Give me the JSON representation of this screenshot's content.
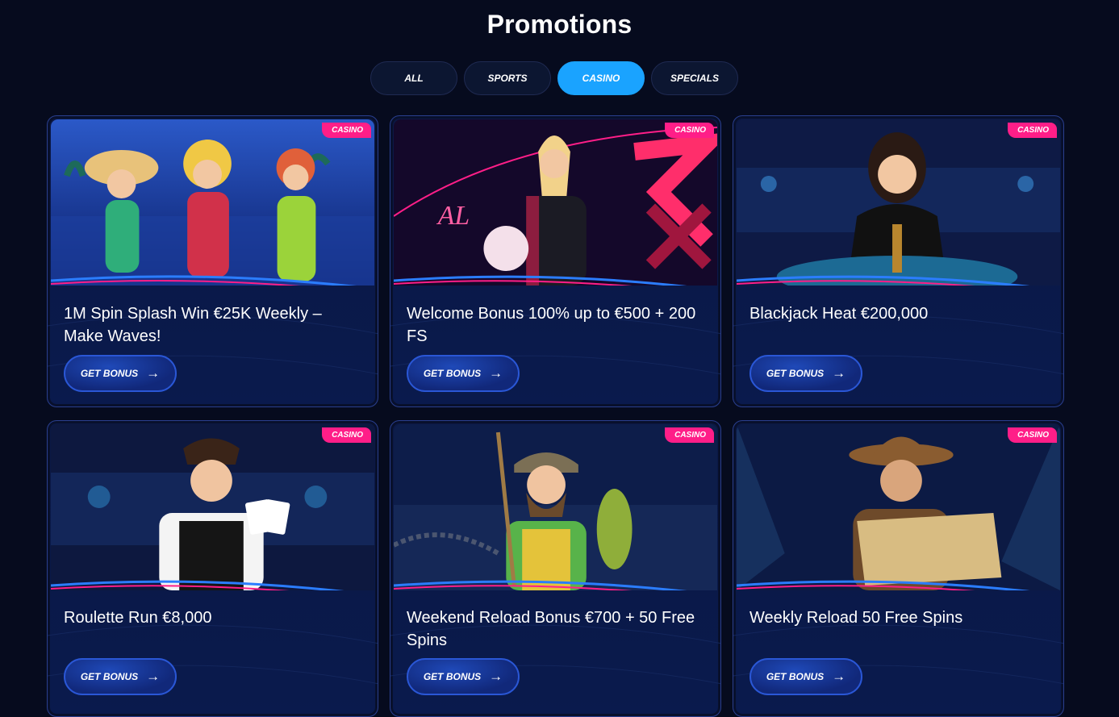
{
  "page": {
    "title": "Promotions"
  },
  "tabs": [
    {
      "label": "ALL",
      "active": false
    },
    {
      "label": "SPORTS",
      "active": false
    },
    {
      "label": "CASINO",
      "active": true
    },
    {
      "label": "SPECIALS",
      "active": false
    }
  ],
  "colors": {
    "background": "#060b1e",
    "accent": "#1aa3ff",
    "badge": "#ff1e88",
    "card_border": "#2a3f8f"
  },
  "cards": [
    {
      "badge": "CASINO",
      "title": "1M Spin Splash Win €25K Weekly – Make Waves!",
      "button": "GET BONUS",
      "art": "three-pool-party-women"
    },
    {
      "badge": "CASINO",
      "title": "Welcome Bonus 100% up to €500 + 200 FS",
      "button": "GET BONUS",
      "art": "football-player-woman"
    },
    {
      "badge": "CASINO",
      "title": "Blackjack Heat €200,000",
      "button": "GET BONUS",
      "art": "croupier-woman"
    },
    {
      "badge": "CASINO",
      "title": "Roulette Run €8,000",
      "button": "GET BONUS",
      "art": "croupier-man-cards"
    },
    {
      "badge": "CASINO",
      "title": "Weekend Reload Bonus €700 + 50 Free Spins",
      "button": "GET BONUS",
      "art": "fisherman-with-fish"
    },
    {
      "badge": "CASINO",
      "title": "Weekly Reload 50 Free Spins",
      "button": "GET BONUS",
      "art": "cowboy-treasure-map"
    }
  ]
}
